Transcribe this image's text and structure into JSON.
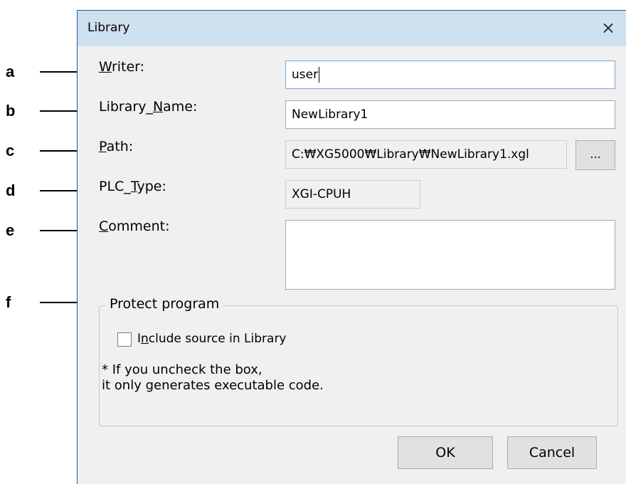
{
  "annotations": [
    "a",
    "b",
    "c",
    "d",
    "e",
    "f"
  ],
  "dialog": {
    "title": "Library",
    "close_glyph": "×"
  },
  "form": {
    "writer": {
      "label_pre": "",
      "label_u": "W",
      "label_post": "riter:",
      "value": "user"
    },
    "library_name": {
      "label_pre": "Library_",
      "label_u": "N",
      "label_post": "ame:",
      "value": "NewLibrary1"
    },
    "path": {
      "label_pre": "",
      "label_u": "P",
      "label_post": "ath:",
      "value": "C:₩XG5000₩Library₩NewLibrary1.xgl",
      "browse_label": "..."
    },
    "plc_type": {
      "label_pre": "PLC_",
      "label_u": "T",
      "label_post": "ype:",
      "value": "XGI-CPUH"
    },
    "comment": {
      "label_pre": "",
      "label_u": "C",
      "label_post": "omment:",
      "value": ""
    }
  },
  "protect": {
    "group_title": "Protect program",
    "checkbox_label_pre": "I",
    "checkbox_label_u": "n",
    "checkbox_label_post": "clude source in Library",
    "checked": false,
    "note_line1": "* If you uncheck the box,",
    "note_line2": "it only generates executable code."
  },
  "buttons": {
    "ok": "OK",
    "cancel": "Cancel"
  }
}
